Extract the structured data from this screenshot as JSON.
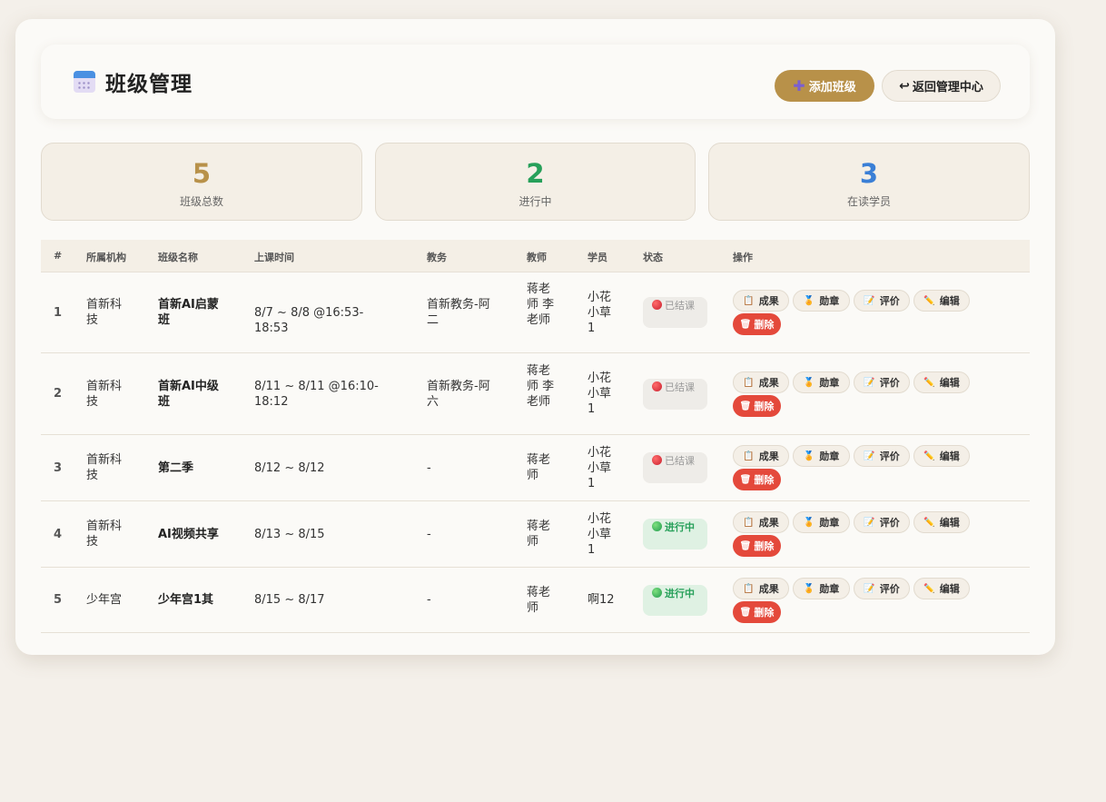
{
  "header": {
    "title": "班级管理",
    "title_icon": "calendar-icon",
    "add_button": "添加班级",
    "back_button": "返回管理中心"
  },
  "stats": [
    {
      "value": "5",
      "label": "班级总数",
      "color": "#b89149"
    },
    {
      "value": "2",
      "label": "进行中",
      "color": "#27a05a"
    },
    {
      "value": "3",
      "label": "在读学员",
      "color": "#3a7fd6"
    }
  ],
  "table": {
    "headers": [
      "#",
      "所属机构",
      "班级名称",
      "上课时间",
      "教务",
      "教师",
      "学员",
      "状态",
      "操作"
    ],
    "actions": {
      "result": "成果",
      "badge": "勋章",
      "review": "评价",
      "edit": "编辑",
      "delete": "删除"
    },
    "rows": [
      {
        "idx": "1",
        "org": "首新科技",
        "name": "首新AI启蒙班",
        "time": "8/7 ~ 8/8 @16:53-18:53",
        "admin": "首新教务-阿二",
        "teacher": "蒋老师 李老师",
        "students": "小花 小草 1",
        "status": "已结课",
        "status_type": "done"
      },
      {
        "idx": "2",
        "org": "首新科技",
        "name": "首新AI中级班",
        "time": "8/11 ~ 8/11 @16:10-18:12",
        "admin": "首新教务-阿六",
        "teacher": "蒋老师 李老师",
        "students": "小花 小草 1",
        "status": "已结课",
        "status_type": "done"
      },
      {
        "idx": "3",
        "org": "首新科技",
        "name": "第二季",
        "time": "8/12 ~ 8/12",
        "admin": "-",
        "teacher": "蒋老师",
        "students": "小花 小草 1",
        "status": "已结课",
        "status_type": "done"
      },
      {
        "idx": "4",
        "org": "首新科技",
        "name": "AI视频共享",
        "time": "8/13 ~ 8/15",
        "admin": "-",
        "teacher": "蒋老师",
        "students": "小花 小草 1",
        "status": "进行中",
        "status_type": "active"
      },
      {
        "idx": "5",
        "org": "少年宫",
        "name": "少年宫1其",
        "time": "8/15 ~ 8/17",
        "admin": "-",
        "teacher": "蒋老师",
        "students": "啊12",
        "status": "进行中",
        "status_type": "active"
      }
    ]
  }
}
